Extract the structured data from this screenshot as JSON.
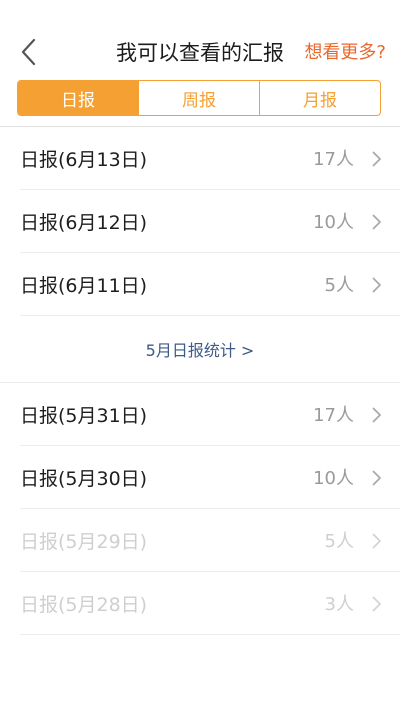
{
  "header": {
    "title": "我可以查看的汇报",
    "more_link": "想看更多?"
  },
  "tabs": [
    {
      "label": "日报"
    },
    {
      "label": "周报"
    },
    {
      "label": "月报"
    }
  ],
  "reports_recent": [
    {
      "label": "日报(6月13日)",
      "count": "17人"
    },
    {
      "label": "日报(6月12日)",
      "count": "10人"
    },
    {
      "label": "日报(6月11日)",
      "count": "5人"
    }
  ],
  "stat_link": "5月日报统计 >",
  "reports_may": [
    {
      "label": "日报(5月31日)",
      "count": "17人"
    },
    {
      "label": "日报(5月30日)",
      "count": "10人"
    },
    {
      "label": "日报(5月29日)",
      "count": "5人"
    },
    {
      "label": "日报(5月28日)",
      "count": "3人"
    }
  ],
  "colors": {
    "accent": "#f5a032",
    "link_orange": "#e8692e",
    "link_blue": "#3d5a88"
  }
}
